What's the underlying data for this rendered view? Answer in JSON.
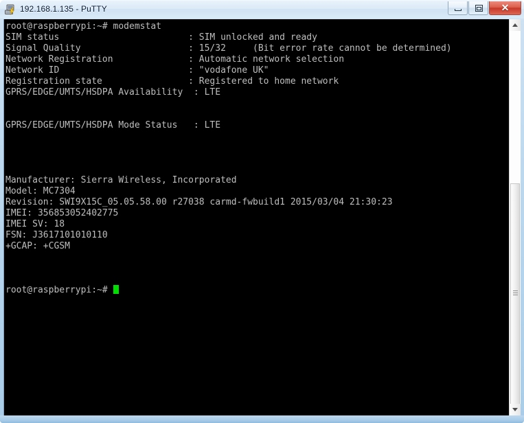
{
  "window": {
    "title": "192.168.1.135 - PuTTY",
    "icon": "putty-computer-icon",
    "host": "192.168.1.135",
    "app": "PuTTY",
    "controls": {
      "minimize_label": "Minimize",
      "maximize_label": "Maximize",
      "close_label": "✕"
    }
  },
  "terminal": {
    "foreground_color": "#bebebe",
    "background_color": "#000000",
    "cursor_color": "#00dd00",
    "prompt": "root@raspberrypi:~#",
    "command": "modemstat",
    "status": [
      {
        "label": "SIM status",
        "value": "SIM unlocked and ready"
      },
      {
        "label": "Signal Quality",
        "value": "15/32     (Bit error rate cannot be determined)"
      },
      {
        "label": "Network Registration",
        "value": "Automatic network selection"
      },
      {
        "label": "Network ID",
        "value": "\"vodafone UK\""
      },
      {
        "label": "Registration state",
        "value": "Registered to home network"
      },
      {
        "label": "GPRS/EDGE/UMTS/HSDPA Availability",
        "value": "LTE"
      },
      {
        "label": "GPRS/EDGE/UMTS/HSDPA Mode Status",
        "value": "LTE"
      }
    ],
    "device_info": [
      "Manufacturer: Sierra Wireless, Incorporated",
      "Model: MC7304",
      "Revision: SWI9X15C_05.05.58.00 r27038 carmd-fwbuild1 2015/03/04 21:30:23",
      "IMEI: 356853052402775",
      "IMEI SV: 18",
      "FSN: J3617101010110",
      "+GCAP: +CGSM"
    ],
    "screen_text": "root@raspberrypi:~# modemstat\nSIM status                        : SIM unlocked and ready\nSignal Quality                    : 15/32     (Bit error rate cannot be determined)\nNetwork Registration              : Automatic network selection\nNetwork ID                        : \"vodafone UK\"\nRegistration state                : Registered to home network\nGPRS/EDGE/UMTS/HSDPA Availability  : LTE\n\n\nGPRS/EDGE/UMTS/HSDPA Mode Status   : LTE\n\n\n\n\nManufacturer: Sierra Wireless, Incorporated\nModel: MC7304\nRevision: SWI9X15C_05.05.58.00 r27038 carmd-fwbuild1 2015/03/04 21:30:23\nIMEI: 356853052402775\nIMEI SV: 18\nFSN: J3617101010110\n+GCAP: +CGSM\n\n\n\nroot@raspberrypi:~# "
  },
  "scrollbar": {
    "up_arrow": "scroll-up-arrow",
    "down_arrow": "scroll-down-arrow",
    "thumb": "scroll-thumb"
  }
}
